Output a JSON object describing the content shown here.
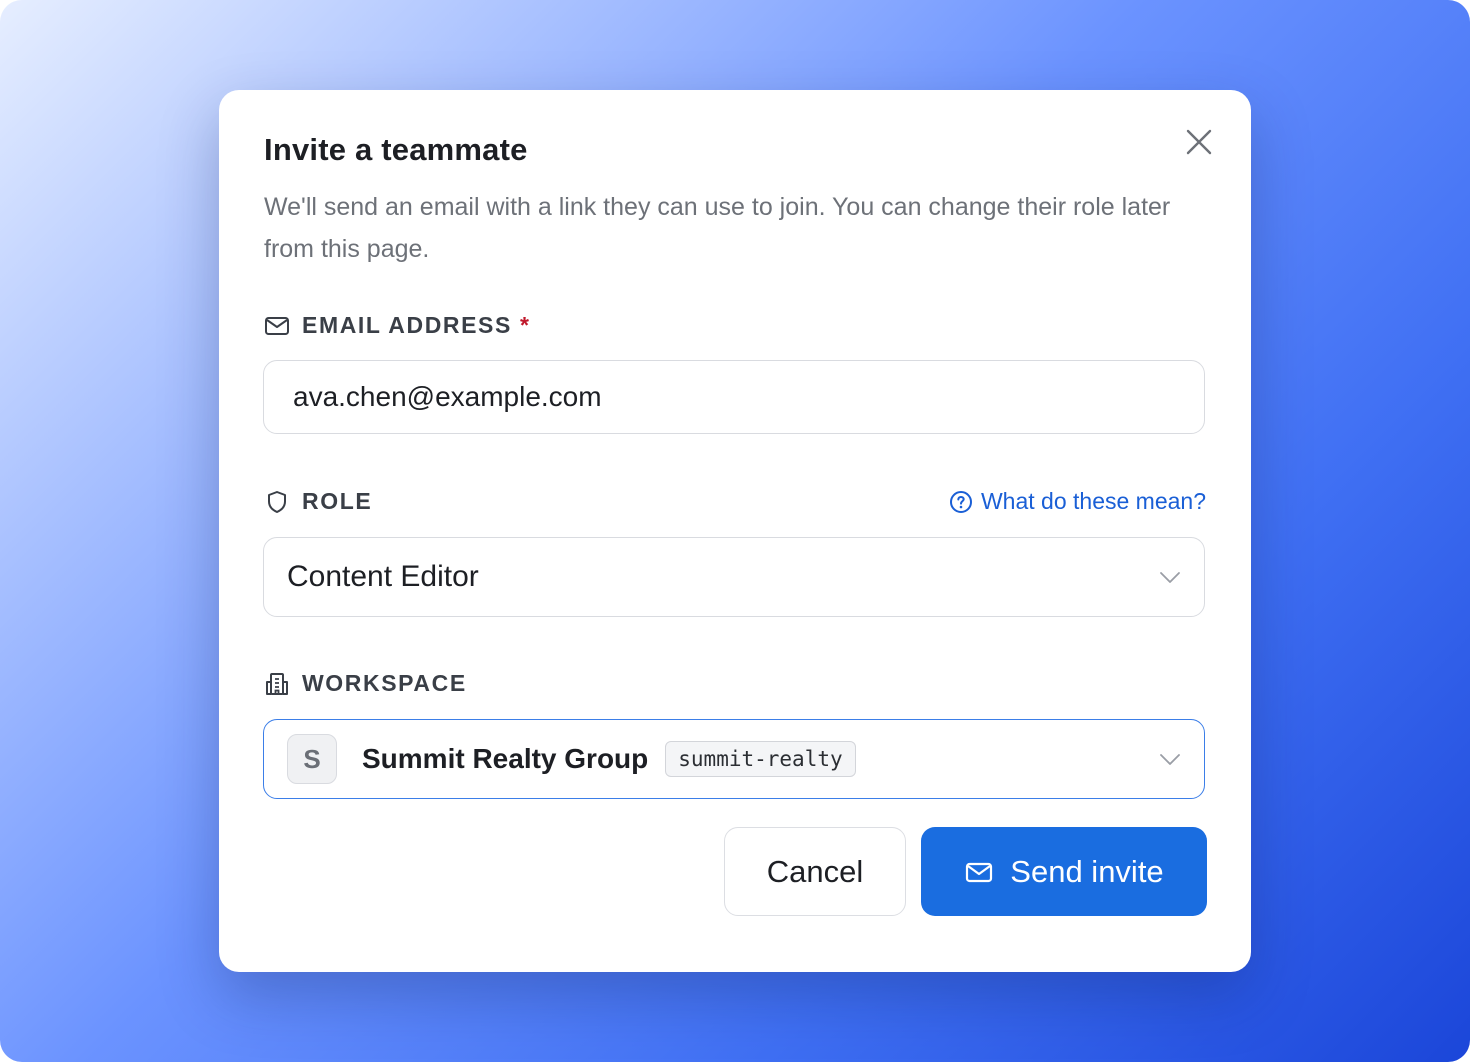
{
  "dialog": {
    "title": "Invite a teammate",
    "description": "We'll send an email with a link they can use to join. You can change their role later from this page."
  },
  "email": {
    "label": "EMAIL ADDRESS",
    "required_marker": "*",
    "value": "ava.chen@example.com"
  },
  "role": {
    "label": "ROLE",
    "help_link": "What do these mean?",
    "selected": "Content Editor"
  },
  "workspace": {
    "label": "WORKSPACE",
    "avatar_letter": "S",
    "name": "Summit Realty Group",
    "slug": "summit-realty"
  },
  "actions": {
    "cancel_label": "Cancel",
    "send_label": "Send invite"
  },
  "colors": {
    "primary": "#1a6de0",
    "link": "#1a5fd6",
    "required": "#c0182b",
    "focus_border": "#3b7ee8"
  },
  "icons": {
    "close": "close-icon",
    "email": "mail-icon",
    "role": "shield-icon",
    "workspace": "building-icon",
    "help": "help-circle-icon",
    "dropdown": "chevron-down-icon"
  }
}
